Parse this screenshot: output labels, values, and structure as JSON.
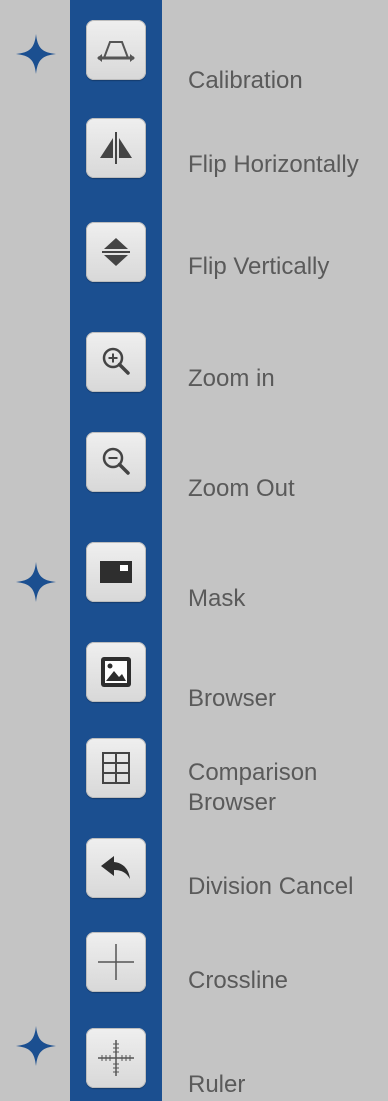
{
  "colors": {
    "background": "#c4c4c4",
    "strip": "#1b4f90",
    "star": "#1b4f90",
    "button": "#e2e2e2",
    "label": "#5a5a5a"
  },
  "tools": [
    {
      "label": "Calibration",
      "icon": "calibration-icon",
      "starred": true
    },
    {
      "label": "Flip Horizontally",
      "icon": "flip-horizontal-icon",
      "starred": false
    },
    {
      "label": "Flip Vertically",
      "icon": "flip-vertical-icon",
      "starred": false
    },
    {
      "label": "Zoom in",
      "icon": "zoom-in-icon",
      "starred": false
    },
    {
      "label": "Zoom Out",
      "icon": "zoom-out-icon",
      "starred": false
    },
    {
      "label": "Mask",
      "icon": "mask-icon",
      "starred": true
    },
    {
      "label": "Browser",
      "icon": "image-browser-icon",
      "starred": false
    },
    {
      "label": "Comparison\nBrowser",
      "icon": "grid-compare-icon",
      "starred": false
    },
    {
      "label": "Division Cancel",
      "icon": "undo-arrow-icon",
      "starred": false
    },
    {
      "label": "Crossline",
      "icon": "crossline-icon",
      "starred": false
    },
    {
      "label": "Ruler",
      "icon": "ruler-crosshair-icon",
      "starred": true
    }
  ]
}
